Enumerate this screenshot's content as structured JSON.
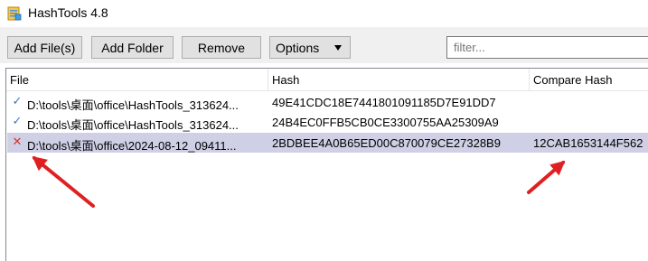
{
  "window": {
    "title": "HashTools 4.8"
  },
  "toolbar": {
    "add_files_label": "Add File(s)",
    "add_folder_label": "Add Folder",
    "remove_label": "Remove",
    "options_label": "Options",
    "filter_placeholder": "filter..."
  },
  "columns": {
    "file": "File",
    "hash": "Hash",
    "compare": "Compare Hash"
  },
  "rows": [
    {
      "status": "ok",
      "status_icon": "check-icon",
      "file": "D:\\tools\\桌面\\office\\HashTools_313624...",
      "hash": "49E41CDC18E7441801091185D7E91DD7",
      "compare": ""
    },
    {
      "status": "ok",
      "status_icon": "check-icon",
      "file": "D:\\tools\\桌面\\office\\HashTools_313624...",
      "hash": "24B4EC0FFB5CB0CE3300755AA25309A9",
      "compare": ""
    },
    {
      "status": "fail",
      "status_icon": "cross-icon",
      "file": "D:\\tools\\桌面\\office\\2024-08-12_09411...",
      "hash": "2BDBEE4A0B65ED00C870079CE27328B9",
      "compare": "12CAB1653144F562"
    }
  ],
  "colors": {
    "selected_row": "#cfcfe6",
    "check": "#3c78c8",
    "cross": "#d83232",
    "arrow": "#e02020"
  }
}
